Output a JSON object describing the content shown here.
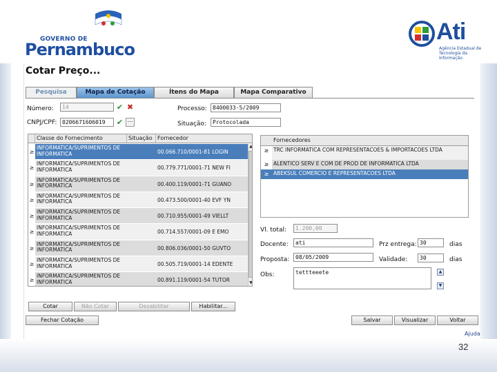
{
  "branding": {
    "gov_small": "GOVERNO DE",
    "gov_big": "Pernambuco",
    "ati_word": "Ati",
    "ati_sub": "Agência Estadual de Tecnologia da Informação"
  },
  "slide": {
    "page_number": "32"
  },
  "window": {
    "title": "Cotar Preço..."
  },
  "tabs": [
    {
      "label": "Pesquisa"
    },
    {
      "label": "Mapa de Cotação"
    },
    {
      "label": "Ítens do Mapa"
    },
    {
      "label": "Mapa Comparativo"
    }
  ],
  "form": {
    "numero_label": "Número:",
    "numero_value": "14",
    "cnpj_label": "CNPJ/CPF:",
    "cnpj_value": "0206671606019",
    "processo_label": "Processo:",
    "processo_value": "8400033-5/2009",
    "situacao_label": "Situação:",
    "situacao_value": "Protocolada"
  },
  "materials": {
    "columns": [
      "Classe do Fornecimento",
      "Situação",
      "Fornecedor"
    ],
    "rows": [
      {
        "classe": "INFORMATICA/SUPRIMENTOS DE INFORMATICA",
        "fornecedor": "00.066.710/0001-81 LOGIN"
      },
      {
        "classe": "INFORMATICA/SUPRIMENTOS DE INFORMATICA",
        "fornecedor": "00.779.771/0001-71 NEW FI"
      },
      {
        "classe": "INFORMATICA/SUPRIMENTOS DE INFORMATICA",
        "fornecedor": "00.400.119/0001-71 GUANO"
      },
      {
        "classe": "INFORMATICA/SUPRIMENTOS DE INFORMATICA",
        "fornecedor": "00.473.500/0001-40 EVF YN"
      },
      {
        "classe": "INFORMATICA/SUPRIMENTOS DE INFORMATICA",
        "fornecedor": "00.710.955/0001-49 VIELLT"
      },
      {
        "classe": "INFORMATICA/SUPRIMENTOS DE INFORMATICA",
        "fornecedor": "00.714.557/0001-09 E EMO"
      },
      {
        "classe": "INFORMATICA/SUPRIMENTOS DE INFORMATICA",
        "fornecedor": "00.806.036/0001-50 GUVTO"
      },
      {
        "classe": "INFORMATICA/SUPRIMENTOS DE INFORMATICA",
        "fornecedor": "00.505.719/0001-14 EDENTE"
      },
      {
        "classe": "INFORMATICA/SUPRIMENTOS DE INFORMATICA",
        "fornecedor": "00.891.119/0001-54 TUTOR"
      }
    ]
  },
  "suppliers": {
    "header": "Fornecedores",
    "rows": [
      {
        "name": "TRC INFORMATICA COM REPRESENTACOES & IMPORTACOES LTDA"
      },
      {
        "name": "ALENTICO SERV E COM DE PROD DE INFORMATICA LTDA"
      },
      {
        "name": "ABEKSUL COMERCIO E REPRESENTACOES LTDA"
      }
    ]
  },
  "details": {
    "vl_total_label": "Vl. total:",
    "vl_total_value": "1.200,00",
    "docente_label": "Docente:",
    "docente_value": "ati",
    "prazo_label": "Prz entrega:",
    "prazo_value": "30",
    "prazo_unit": "dias",
    "proposta_label": "Proposta:",
    "proposta_value": "08/05/2009",
    "validade_label": "Validade:",
    "validade_value": "30",
    "validade_unit": "dias",
    "obs_label": "Obs:",
    "obs_value": "tettteeete"
  },
  "buttons": {
    "cotar": "Cotar",
    "nao_cotar": "Não Cotar",
    "desabilitar": "Desabilitar",
    "habilitar": "Habilitar...",
    "fechar_cotacao": "Fechar Cotação",
    "salvar": "Salvar",
    "visualizar": "Visualizar",
    "voltar": "Voltar",
    "ajuda": "Ajuda"
  },
  "icons": [
    "check-icon",
    "delete-icon",
    "lookup-icon",
    "scroll-up-icon",
    "scroll-down-icon",
    "row-select-icon"
  ]
}
